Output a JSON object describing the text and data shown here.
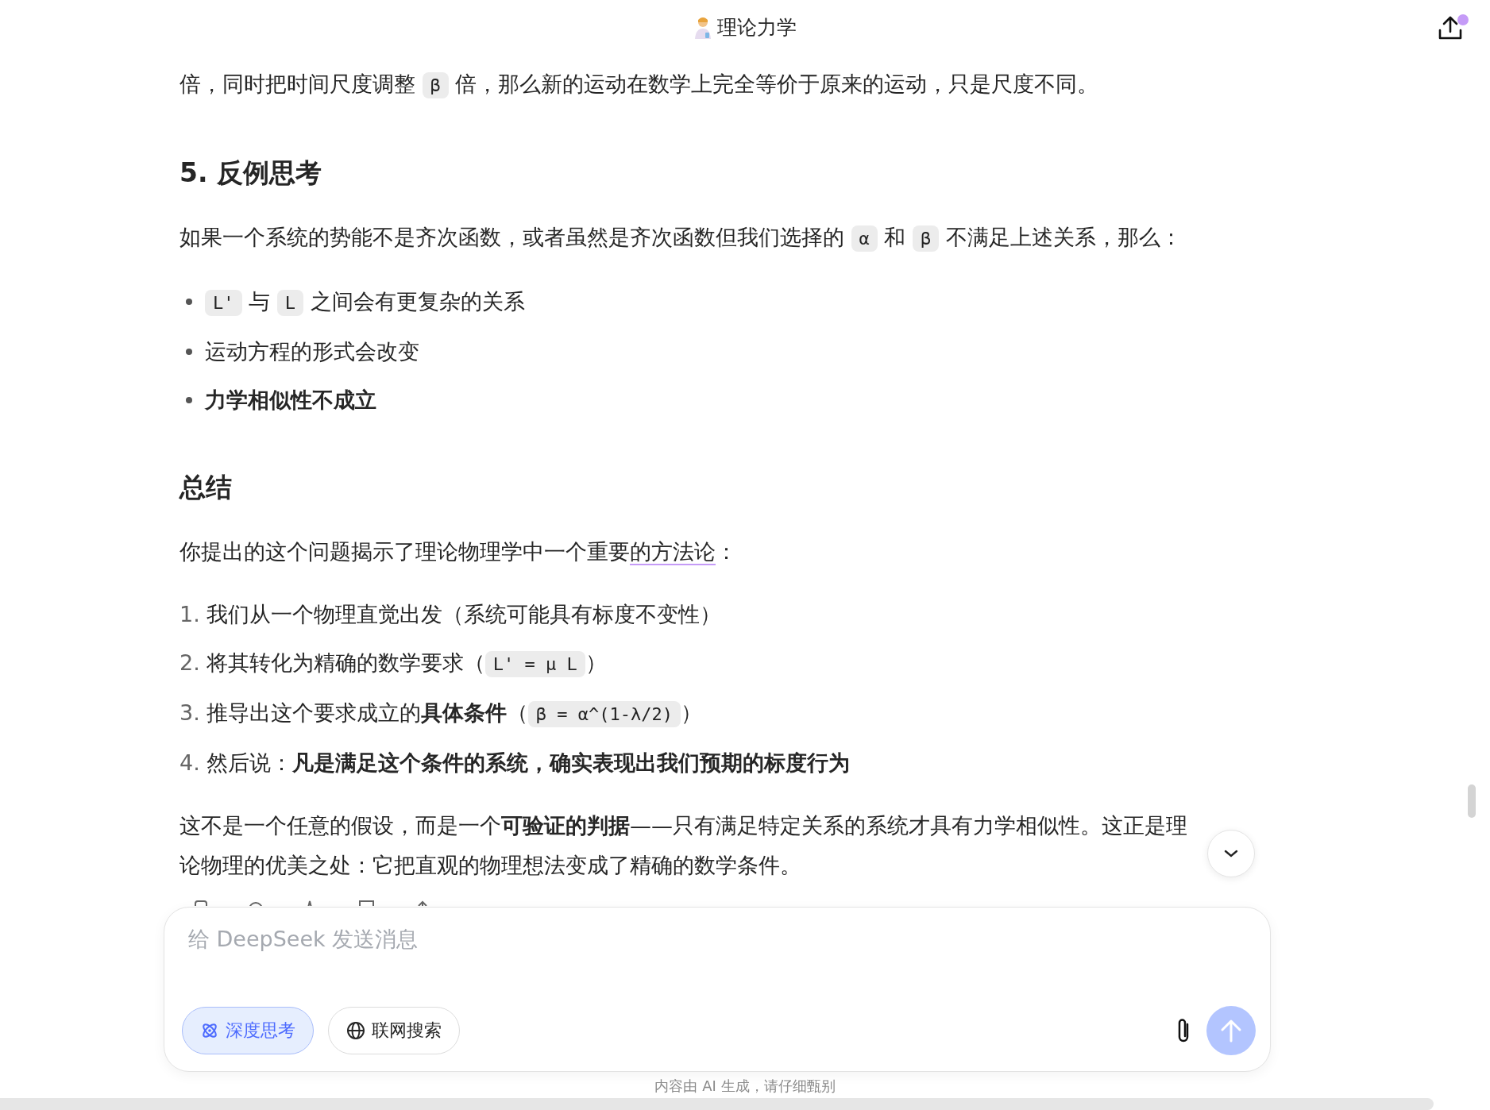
{
  "header": {
    "title": "理论力学"
  },
  "content": [
    {
      "kind": "p",
      "parts": [
        {
          "kind": "text",
          "text": "倍，同时把时间尺度调整 "
        },
        {
          "kind": "code",
          "text": "β"
        },
        {
          "kind": "text",
          "text": " 倍，那么新的运动在数学上完全等价于原来的运动，只是尺度不同。"
        }
      ]
    },
    {
      "kind": "h3",
      "parts": [
        {
          "kind": "text",
          "text": "5. 反例思考"
        }
      ]
    },
    {
      "kind": "p",
      "parts": [
        {
          "kind": "text",
          "text": "如果一个系统的势能不是齐次函数，或者虽然是齐次函数但我们选择的 "
        },
        {
          "kind": "code",
          "text": "α"
        },
        {
          "kind": "text",
          "text": " 和 "
        },
        {
          "kind": "code",
          "text": "β"
        },
        {
          "kind": "text",
          "text": " 不满足上述关系，那么："
        }
      ]
    },
    {
      "kind": "bullet",
      "parts": [
        {
          "kind": "code",
          "text": "L'"
        },
        {
          "kind": "text",
          "text": " 与 "
        },
        {
          "kind": "code",
          "text": "L"
        },
        {
          "kind": "text",
          "text": " 之间会有更复杂的关系"
        }
      ]
    },
    {
      "kind": "bullet",
      "parts": [
        {
          "kind": "text",
          "text": "运动方程的形式会改变"
        }
      ]
    },
    {
      "kind": "bullet",
      "parts": [
        {
          "kind": "bold",
          "text": "力学相似性不成立"
        }
      ]
    },
    {
      "kind": "h3",
      "parts": [
        {
          "kind": "text",
          "text": "总结"
        }
      ]
    },
    {
      "kind": "p",
      "parts": [
        {
          "kind": "text",
          "text": "你提出的这个问题揭示了理论物理学中一个重要"
        },
        {
          "kind": "underline",
          "text": "的方法论"
        },
        {
          "kind": "text",
          "text": "："
        }
      ]
    },
    {
      "kind": "numbered",
      "number": "1.",
      "parts": [
        {
          "kind": "text",
          "text": "我们从一个物理直觉出发（系统可能具有标度不变性）"
        }
      ]
    },
    {
      "kind": "numbered",
      "number": "2.",
      "parts": [
        {
          "kind": "text",
          "text": "将其转化为精确的数学要求（"
        },
        {
          "kind": "code",
          "text": "L' = μ L"
        },
        {
          "kind": "text",
          "text": "）"
        }
      ]
    },
    {
      "kind": "numbered",
      "number": "3.",
      "parts": [
        {
          "kind": "text",
          "text": "推导出这个要求成立的"
        },
        {
          "kind": "bold",
          "text": "具体条件"
        },
        {
          "kind": "text",
          "text": "（"
        },
        {
          "kind": "code",
          "text": "β = α^(1-λ/2)"
        },
        {
          "kind": "text",
          "text": "）"
        }
      ]
    },
    {
      "kind": "numbered",
      "number": "4.",
      "parts": [
        {
          "kind": "text",
          "text": "然后说："
        },
        {
          "kind": "bold",
          "text": "凡是满足这个条件的系统，确实表现出我们预期的标度行为"
        }
      ]
    },
    {
      "kind": "p",
      "parts": [
        {
          "kind": "text",
          "text": "这不是一个任意的假设，而是一个"
        },
        {
          "kind": "bold",
          "text": "可验证的判据"
        },
        {
          "kind": "text",
          "text": "——只有满足特定关系的系统才具有力学相似性。这正是理论物理的优美之处：它把直观的物理想法变成了精确的数学条件。"
        }
      ]
    }
  ],
  "composer": {
    "placeholder": "给 DeepSeek 发送消息",
    "toggles": [
      {
        "label": "深度思考",
        "selected": true,
        "kind": "atom"
      },
      {
        "label": "联网搜索",
        "selected": false,
        "kind": "globe"
      }
    ],
    "send_disabled": true
  },
  "footer": "内容由 AI 生成，请仔细甄别"
}
